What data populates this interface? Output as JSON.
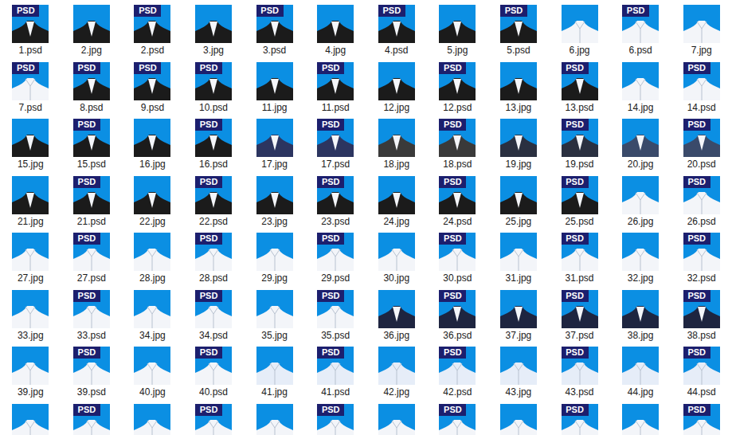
{
  "psd_badge": "PSD",
  "files": [
    {
      "label": "1.psd",
      "kind": "psd",
      "color": "#1b1b1b"
    },
    {
      "label": "2.jpg",
      "kind": "jpg",
      "color": "#1b1b1b"
    },
    {
      "label": "2.psd",
      "kind": "psd",
      "color": "#1b1b1b"
    },
    {
      "label": "3.jpg",
      "kind": "jpg",
      "color": "#1b1b1b"
    },
    {
      "label": "3.psd",
      "kind": "psd",
      "color": "#1b1b1b"
    },
    {
      "label": "4.jpg",
      "kind": "jpg",
      "color": "#1b1b1b"
    },
    {
      "label": "4.psd",
      "kind": "psd",
      "color": "#1b1b1b"
    },
    {
      "label": "5.jpg",
      "kind": "jpg",
      "color": "#1b1b1b"
    },
    {
      "label": "5.psd",
      "kind": "psd",
      "color": "#1b1b1b"
    },
    {
      "label": "6.jpg",
      "kind": "jpg",
      "color": "#f3f5f9"
    },
    {
      "label": "6.psd",
      "kind": "psd",
      "color": "#f3f5f9"
    },
    {
      "label": "7.jpg",
      "kind": "jpg",
      "color": "#f3f5f9"
    },
    {
      "label": "7.psd",
      "kind": "psd",
      "color": "#f3f5f9"
    },
    {
      "label": "8.psd",
      "kind": "psd",
      "color": "#1b1b1b"
    },
    {
      "label": "9.psd",
      "kind": "psd",
      "color": "#1b1b1b"
    },
    {
      "label": "10.psd",
      "kind": "psd",
      "color": "#1b1b1b"
    },
    {
      "label": "11.jpg",
      "kind": "jpg",
      "color": "#1b1b1b"
    },
    {
      "label": "11.psd",
      "kind": "psd",
      "color": "#1b1b1b"
    },
    {
      "label": "12.jpg",
      "kind": "jpg",
      "color": "#1b1b1b"
    },
    {
      "label": "12.psd",
      "kind": "psd",
      "color": "#1b1b1b"
    },
    {
      "label": "13.jpg",
      "kind": "jpg",
      "color": "#1b1b1b"
    },
    {
      "label": "13.psd",
      "kind": "psd",
      "color": "#1b1b1b"
    },
    {
      "label": "14.jpg",
      "kind": "jpg",
      "color": "#f3f5f9"
    },
    {
      "label": "14.psd",
      "kind": "psd",
      "color": "#f3f5f9"
    },
    {
      "label": "15.jpg",
      "kind": "jpg",
      "color": "#1b1b1b"
    },
    {
      "label": "15.psd",
      "kind": "psd",
      "color": "#1b1b1b"
    },
    {
      "label": "16.jpg",
      "kind": "jpg",
      "color": "#1b1b1b"
    },
    {
      "label": "16.psd",
      "kind": "psd",
      "color": "#1b1b1b"
    },
    {
      "label": "17.jpg",
      "kind": "jpg",
      "color": "#2c3560"
    },
    {
      "label": "17.psd",
      "kind": "psd",
      "color": "#2c3560"
    },
    {
      "label": "18.jpg",
      "kind": "jpg",
      "color": "#3a3a3a"
    },
    {
      "label": "18.psd",
      "kind": "psd",
      "color": "#3a3a3a"
    },
    {
      "label": "19.jpg",
      "kind": "jpg",
      "color": "#2a3040"
    },
    {
      "label": "19.psd",
      "kind": "psd",
      "color": "#2a3040"
    },
    {
      "label": "20.jpg",
      "kind": "jpg",
      "color": "#3a4a6a"
    },
    {
      "label": "20.psd",
      "kind": "psd",
      "color": "#3a4a6a"
    },
    {
      "label": "21.jpg",
      "kind": "jpg",
      "color": "#1b1b1b"
    },
    {
      "label": "21.psd",
      "kind": "psd",
      "color": "#1b1b1b"
    },
    {
      "label": "22.jpg",
      "kind": "jpg",
      "color": "#1b1b1b"
    },
    {
      "label": "22.psd",
      "kind": "psd",
      "color": "#1b1b1b"
    },
    {
      "label": "23.jpg",
      "kind": "jpg",
      "color": "#1b1b1b"
    },
    {
      "label": "23.psd",
      "kind": "psd",
      "color": "#1b1b1b"
    },
    {
      "label": "24.jpg",
      "kind": "jpg",
      "color": "#1b1b1b"
    },
    {
      "label": "24.psd",
      "kind": "psd",
      "color": "#1b1b1b"
    },
    {
      "label": "25.jpg",
      "kind": "jpg",
      "color": "#1b1b1b"
    },
    {
      "label": "25.psd",
      "kind": "psd",
      "color": "#1b1b1b"
    },
    {
      "label": "26.jpg",
      "kind": "jpg",
      "color": "#f3f5f9"
    },
    {
      "label": "26.psd",
      "kind": "psd",
      "color": "#f3f5f9"
    },
    {
      "label": "27.jpg",
      "kind": "jpg",
      "color": "#f3f5f9"
    },
    {
      "label": "27.psd",
      "kind": "psd",
      "color": "#f3f5f9"
    },
    {
      "label": "28.jpg",
      "kind": "jpg",
      "color": "#f3f5f9"
    },
    {
      "label": "28.psd",
      "kind": "psd",
      "color": "#f3f5f9"
    },
    {
      "label": "29.jpg",
      "kind": "jpg",
      "color": "#f3f5f9"
    },
    {
      "label": "29.psd",
      "kind": "psd",
      "color": "#f3f5f9"
    },
    {
      "label": "30.jpg",
      "kind": "jpg",
      "color": "#f3f5f9"
    },
    {
      "label": "30.psd",
      "kind": "psd",
      "color": "#f3f5f9"
    },
    {
      "label": "31.jpg",
      "kind": "jpg",
      "color": "#f3f5f9"
    },
    {
      "label": "31.psd",
      "kind": "psd",
      "color": "#f3f5f9"
    },
    {
      "label": "32.jpg",
      "kind": "jpg",
      "color": "#f3f5f9"
    },
    {
      "label": "32.psd",
      "kind": "psd",
      "color": "#f3f5f9"
    },
    {
      "label": "33.jpg",
      "kind": "jpg",
      "color": "#f3f5f9"
    },
    {
      "label": "33.psd",
      "kind": "psd",
      "color": "#f3f5f9"
    },
    {
      "label": "34.jpg",
      "kind": "jpg",
      "color": "#f3f5f9"
    },
    {
      "label": "34.psd",
      "kind": "psd",
      "color": "#f3f5f9"
    },
    {
      "label": "35.jpg",
      "kind": "jpg",
      "color": "#f3f5f9"
    },
    {
      "label": "35.psd",
      "kind": "psd",
      "color": "#f3f5f9"
    },
    {
      "label": "36.jpg",
      "kind": "jpg",
      "color": "#1e2540"
    },
    {
      "label": "36.psd",
      "kind": "psd",
      "color": "#1e2540"
    },
    {
      "label": "37.jpg",
      "kind": "jpg",
      "color": "#1e2540"
    },
    {
      "label": "37.psd",
      "kind": "psd",
      "color": "#1e2540"
    },
    {
      "label": "38.jpg",
      "kind": "jpg",
      "color": "#1e2540"
    },
    {
      "label": "38.psd",
      "kind": "psd",
      "color": "#1e2540"
    },
    {
      "label": "39.jpg",
      "kind": "jpg",
      "color": "#f3f5f9"
    },
    {
      "label": "39.psd",
      "kind": "psd",
      "color": "#f3f5f9"
    },
    {
      "label": "40.jpg",
      "kind": "jpg",
      "color": "#f3f5f9"
    },
    {
      "label": "40.psd",
      "kind": "psd",
      "color": "#f3f5f9"
    },
    {
      "label": "41.jpg",
      "kind": "jpg",
      "color": "#e6edf8"
    },
    {
      "label": "41.psd",
      "kind": "psd",
      "color": "#e6edf8"
    },
    {
      "label": "42.jpg",
      "kind": "jpg",
      "color": "#e6edf8"
    },
    {
      "label": "42.psd",
      "kind": "psd",
      "color": "#e6edf8"
    },
    {
      "label": "43.jpg",
      "kind": "jpg",
      "color": "#e6edf8"
    },
    {
      "label": "43.psd",
      "kind": "psd",
      "color": "#e6edf8"
    },
    {
      "label": "44.jpg",
      "kind": "jpg",
      "color": "#e6edf8"
    },
    {
      "label": "44.psd",
      "kind": "psd",
      "color": "#e6edf8"
    }
  ],
  "partial_row": [
    {
      "kind": "jpg",
      "color": "#f3f5f9"
    },
    {
      "kind": "psd",
      "color": "#f3f5f9"
    },
    {
      "kind": "jpg",
      "color": "#f3f5f9"
    },
    {
      "kind": "psd",
      "color": "#f3f5f9"
    },
    {
      "kind": "jpg",
      "color": "#f3f5f9"
    },
    {
      "kind": "psd",
      "color": "#f3f5f9"
    },
    {
      "kind": "jpg",
      "color": "#f3f5f9"
    },
    {
      "kind": "psd",
      "color": "#f3f5f9"
    },
    {
      "kind": "jpg",
      "color": "#f3f5f9"
    },
    {
      "kind": "psd",
      "color": "#f3f5f9"
    },
    {
      "kind": "jpg",
      "color": "#f3f5f9"
    },
    {
      "kind": "psd",
      "color": "#f3f5f9"
    }
  ]
}
